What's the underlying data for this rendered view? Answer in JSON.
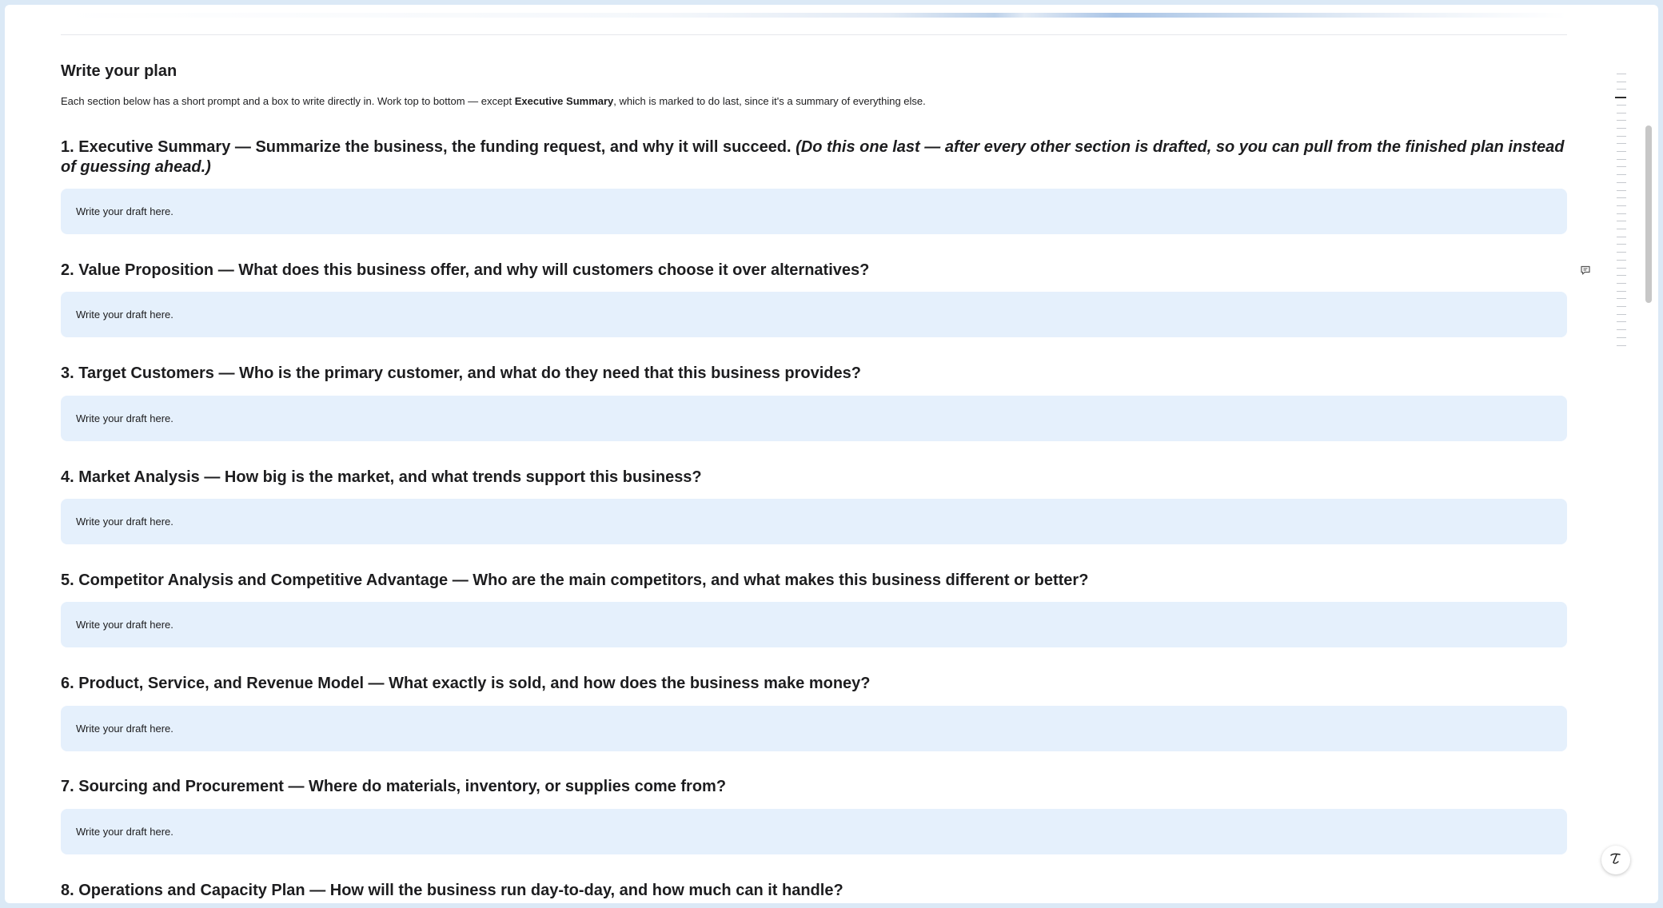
{
  "page": {
    "heading": "Write your plan",
    "intro_before": "Each section below has a short prompt and a box to write directly in. Work top to bottom — except ",
    "intro_bold": "Executive Summary",
    "intro_after": ", which is marked to do last, since it's a summary of everything else."
  },
  "sections": [
    {
      "title": "1. Executive Summary — Summarize the business, the funding request, and why it will succeed. ",
      "hint": "(Do this one last — after every other section is drafted, so you can pull from the finished plan instead of guessing ahead.)",
      "placeholder": "Write your draft here."
    },
    {
      "title": "2. Value Proposition — What does this business offer, and why will customers choose it over alternatives?",
      "placeholder": "Write your draft here."
    },
    {
      "title": "3. Target Customers — Who is the primary customer, and what do they need that this business provides?",
      "placeholder": "Write your draft here."
    },
    {
      "title": "4. Market Analysis — How big is the market, and what trends support this business?",
      "placeholder": "Write your draft here."
    },
    {
      "title": "5. Competitor Analysis and Competitive Advantage — Who are the main competitors, and what makes this business different or better?",
      "placeholder": "Write your draft here."
    },
    {
      "title": "6. Product, Service, and Revenue Model — What exactly is sold, and how does the business make money?",
      "placeholder": "Write your draft here."
    },
    {
      "title": "7. Sourcing and Procurement — Where do materials, inventory, or supplies come from?",
      "placeholder": "Write your draft here."
    },
    {
      "title": "8. Operations and Capacity Plan — How will the business run day-to-day, and how much can it handle?"
    }
  ],
  "icons": {
    "comment": "comment-icon",
    "assistant": "pen-assistant-icon"
  },
  "colors": {
    "draft_box": "#e5f0fc",
    "text": "#1d1d1f",
    "background": "#dbe9f6"
  }
}
